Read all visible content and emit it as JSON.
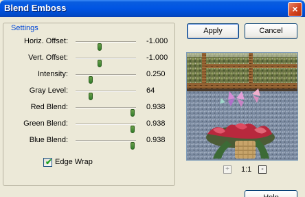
{
  "window": {
    "title": "Blend Emboss",
    "close_glyph": "×"
  },
  "settings": {
    "legend": "Settings",
    "params": [
      {
        "label": "Horiz. Offset:",
        "value": "-1.000",
        "level": 0.4
      },
      {
        "label": "Vert. Offset:",
        "value": "-1.000",
        "level": 0.4
      },
      {
        "label": "Intensity:",
        "value": "0.250",
        "level": 0.25
      },
      {
        "label": "Gray Level:",
        "value": "64",
        "level": 0.25
      },
      {
        "label": "Red Blend:",
        "value": "0.938",
        "level": 0.938
      },
      {
        "label": "Green Blend:",
        "value": "0.938",
        "level": 0.938
      },
      {
        "label": "Blue Blend:",
        "value": "0.938",
        "level": 0.938
      }
    ],
    "edge_wrap": {
      "label": "Edge Wrap",
      "checked": true,
      "check_glyph": "✔"
    }
  },
  "buttons": {
    "apply": "Apply",
    "cancel": "Cancel",
    "help": "Help"
  },
  "zoom": {
    "minus": "-",
    "plus": "+",
    "level": "1:1"
  },
  "preview": {
    "icon": "embossed-photo-preview"
  }
}
